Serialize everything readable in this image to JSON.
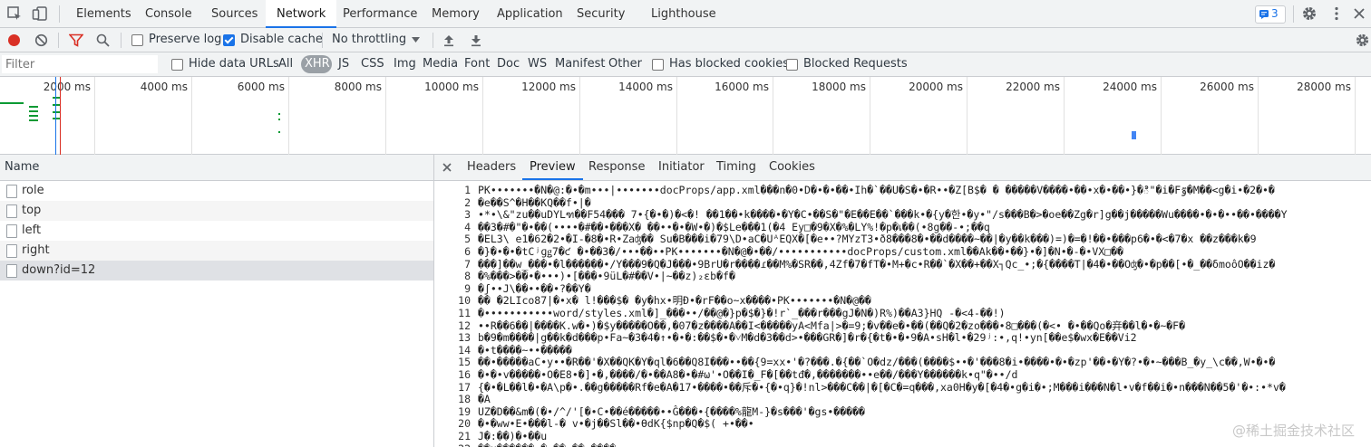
{
  "tabs": [
    "Elements",
    "Console",
    "Sources",
    "Network",
    "Performance",
    "Memory",
    "Application",
    "Security",
    "Lighthouse"
  ],
  "active_tab": "Network",
  "issues_count": "3",
  "toolbar": {
    "preserve_log": "Preserve log",
    "disable_cache": "Disable cache",
    "throttling": "No throttling"
  },
  "filter": {
    "placeholder": "Filter",
    "hide_data_urls": "Hide data URLs",
    "types": [
      "All",
      "XHR",
      "JS",
      "CSS",
      "Img",
      "Media",
      "Font",
      "Doc",
      "WS",
      "Manifest",
      "Other"
    ],
    "active_type": "XHR",
    "has_blocked_cookies": "Has blocked cookies",
    "blocked_requests": "Blocked Requests"
  },
  "timeline_ticks": [
    "2000 ms",
    "4000 ms",
    "6000 ms",
    "8000 ms",
    "10000 ms",
    "12000 ms",
    "14000 ms",
    "16000 ms",
    "18000 ms",
    "20000 ms",
    "22000 ms",
    "24000 ms",
    "26000 ms",
    "28000 ms"
  ],
  "requests": {
    "header": "Name",
    "rows": [
      "role",
      "top",
      "left",
      "right",
      "down?id=12"
    ]
  },
  "detail_tabs": [
    "Headers",
    "Preview",
    "Response",
    "Initiator",
    "Timing",
    "Cookies"
  ],
  "active_detail_tab": "Preview",
  "preview_lines": [
    "PK•••••••�N�@:�•�m•••|•••••••docProps/app.xml���n�0•D�•�•��•Iհ�`��U�S�•�R••�Z[B$� � �����V����•��•x�•��•}�ి\"�i�Fٷ�M��<g�i•�2�•�",
    "�e��S^�H��KQ��f•|�",
    "•*•\\&\"zu��uDYLฑ��F54��� 7•{�•�)�<�! ��1��•k����•�Y�C•��S�\"�E��E��`���k•�{y�한•�y•\"/s���B�>�oe��Zg�r]g��j�����Wu����•�•�••��•����Y",
    "��3�#�\"�•��(••••�#��•���X�  ��••�•�W•�)�$Le���1(�4  Ey□�9�X�%�LY%!�p�เ��(•8g��-•;��q",
    "�EL3\\   e1�62�2•�I-�8�•R•Zaʤ��  Su�B���i�79\\D•aC�UᴬEQX�[�e••?MYzT3•ð8���8�•��d����~��|�y��k���)=)�=�!��•���p6�•�<�7�x     ��z���k�9",
    "�}�•�•�tCʲɡǥ7�ƈ �•��3�/•••��••PK•••••••�N�@�•��/•••••••••••docProps/custom.xml��Ak��•��}•�]�N•�-�•VX□��",
    "���]��w_���•�l������•/Y���9�Q�J���•9BrU�r����ɾ��M%�SR��,4Zf�7�fT�•M+�c•R��`�X��+��X┐Qc_•;�{����T|�4�•��Oʤ�•�p��[•�_��δmoôO��iz�",
    "�%���>��•�•••)•[���•9üL�#��V•|~��z)₂ɛb�f�",
    "�ʃ••J\\��••��•?��Y�",
    "��  �2LIco87|�•x�   l!���$� �y�hx•明Đ•�rF��o~x����•PK•••••••�N�@��",
    "�•••••••••••word/styles.xml�]_���••/��@�}p�$�}�!r`_���r���gJ�N�)R%)��A3}HQ -�<4-��!)",
    "••R��6��|����K.w�•)�$y�����O��,�07�z����A��I<�����yA<Mfa|>�=9;�v��e�•��(��Q�2�zo���•8□���(�<• �•��Qo�竎��l�•�~�F�",
    "b�9�m����|g��k�d���p•Fa~�3�4�↑•�•�:��$�•�˅M�d�3��d>•���GR�]�r�{�t�•�•9�A•sH�l•�29ʲ:•,q!•yn[��e$�wx�E��Vi2",
    "�•t����~••�����",
    "��•�����aC•y••�R��'�X��QK�Y�ql�6��Q8I���••��{9=xx•'�?���.�{��`O�dz/���(����$••�'���8�i•����•�•�zp'��•�Y�?•�•~���B_�y_\\c��,W•�•�",
    "�•�•v�����•O�E8•�]•�,����/�•��A8�•�#ω'•O��I�_F�[��tđ�,�������••e��/���Y������k•q\"�••/d",
    "{�•�L��l�•�A\\p�•.��g�����Rf�e�A�17•����•��斥�•{�•q}�!nl>���C��|�[�C�=q���,xa0H�y�[�4�•g�i�•;M���i���N�l•v�f��i�•n���N��5�'�•:•*v�",
    "�A",
    "UZ�D��&m�(�•/^/'[�•C•��é�����••Ĝ���•{����%龍M-}�s���'�gs•�����",
    "�•�ww•E•���l-�  v•�j��Sl��•ϴdK{$np�Q�$(     +•��•",
    "J�:��)�•��u",
    "��u������_�•��•��•����"
  ],
  "watermark": "@稀土掘金技术社区"
}
